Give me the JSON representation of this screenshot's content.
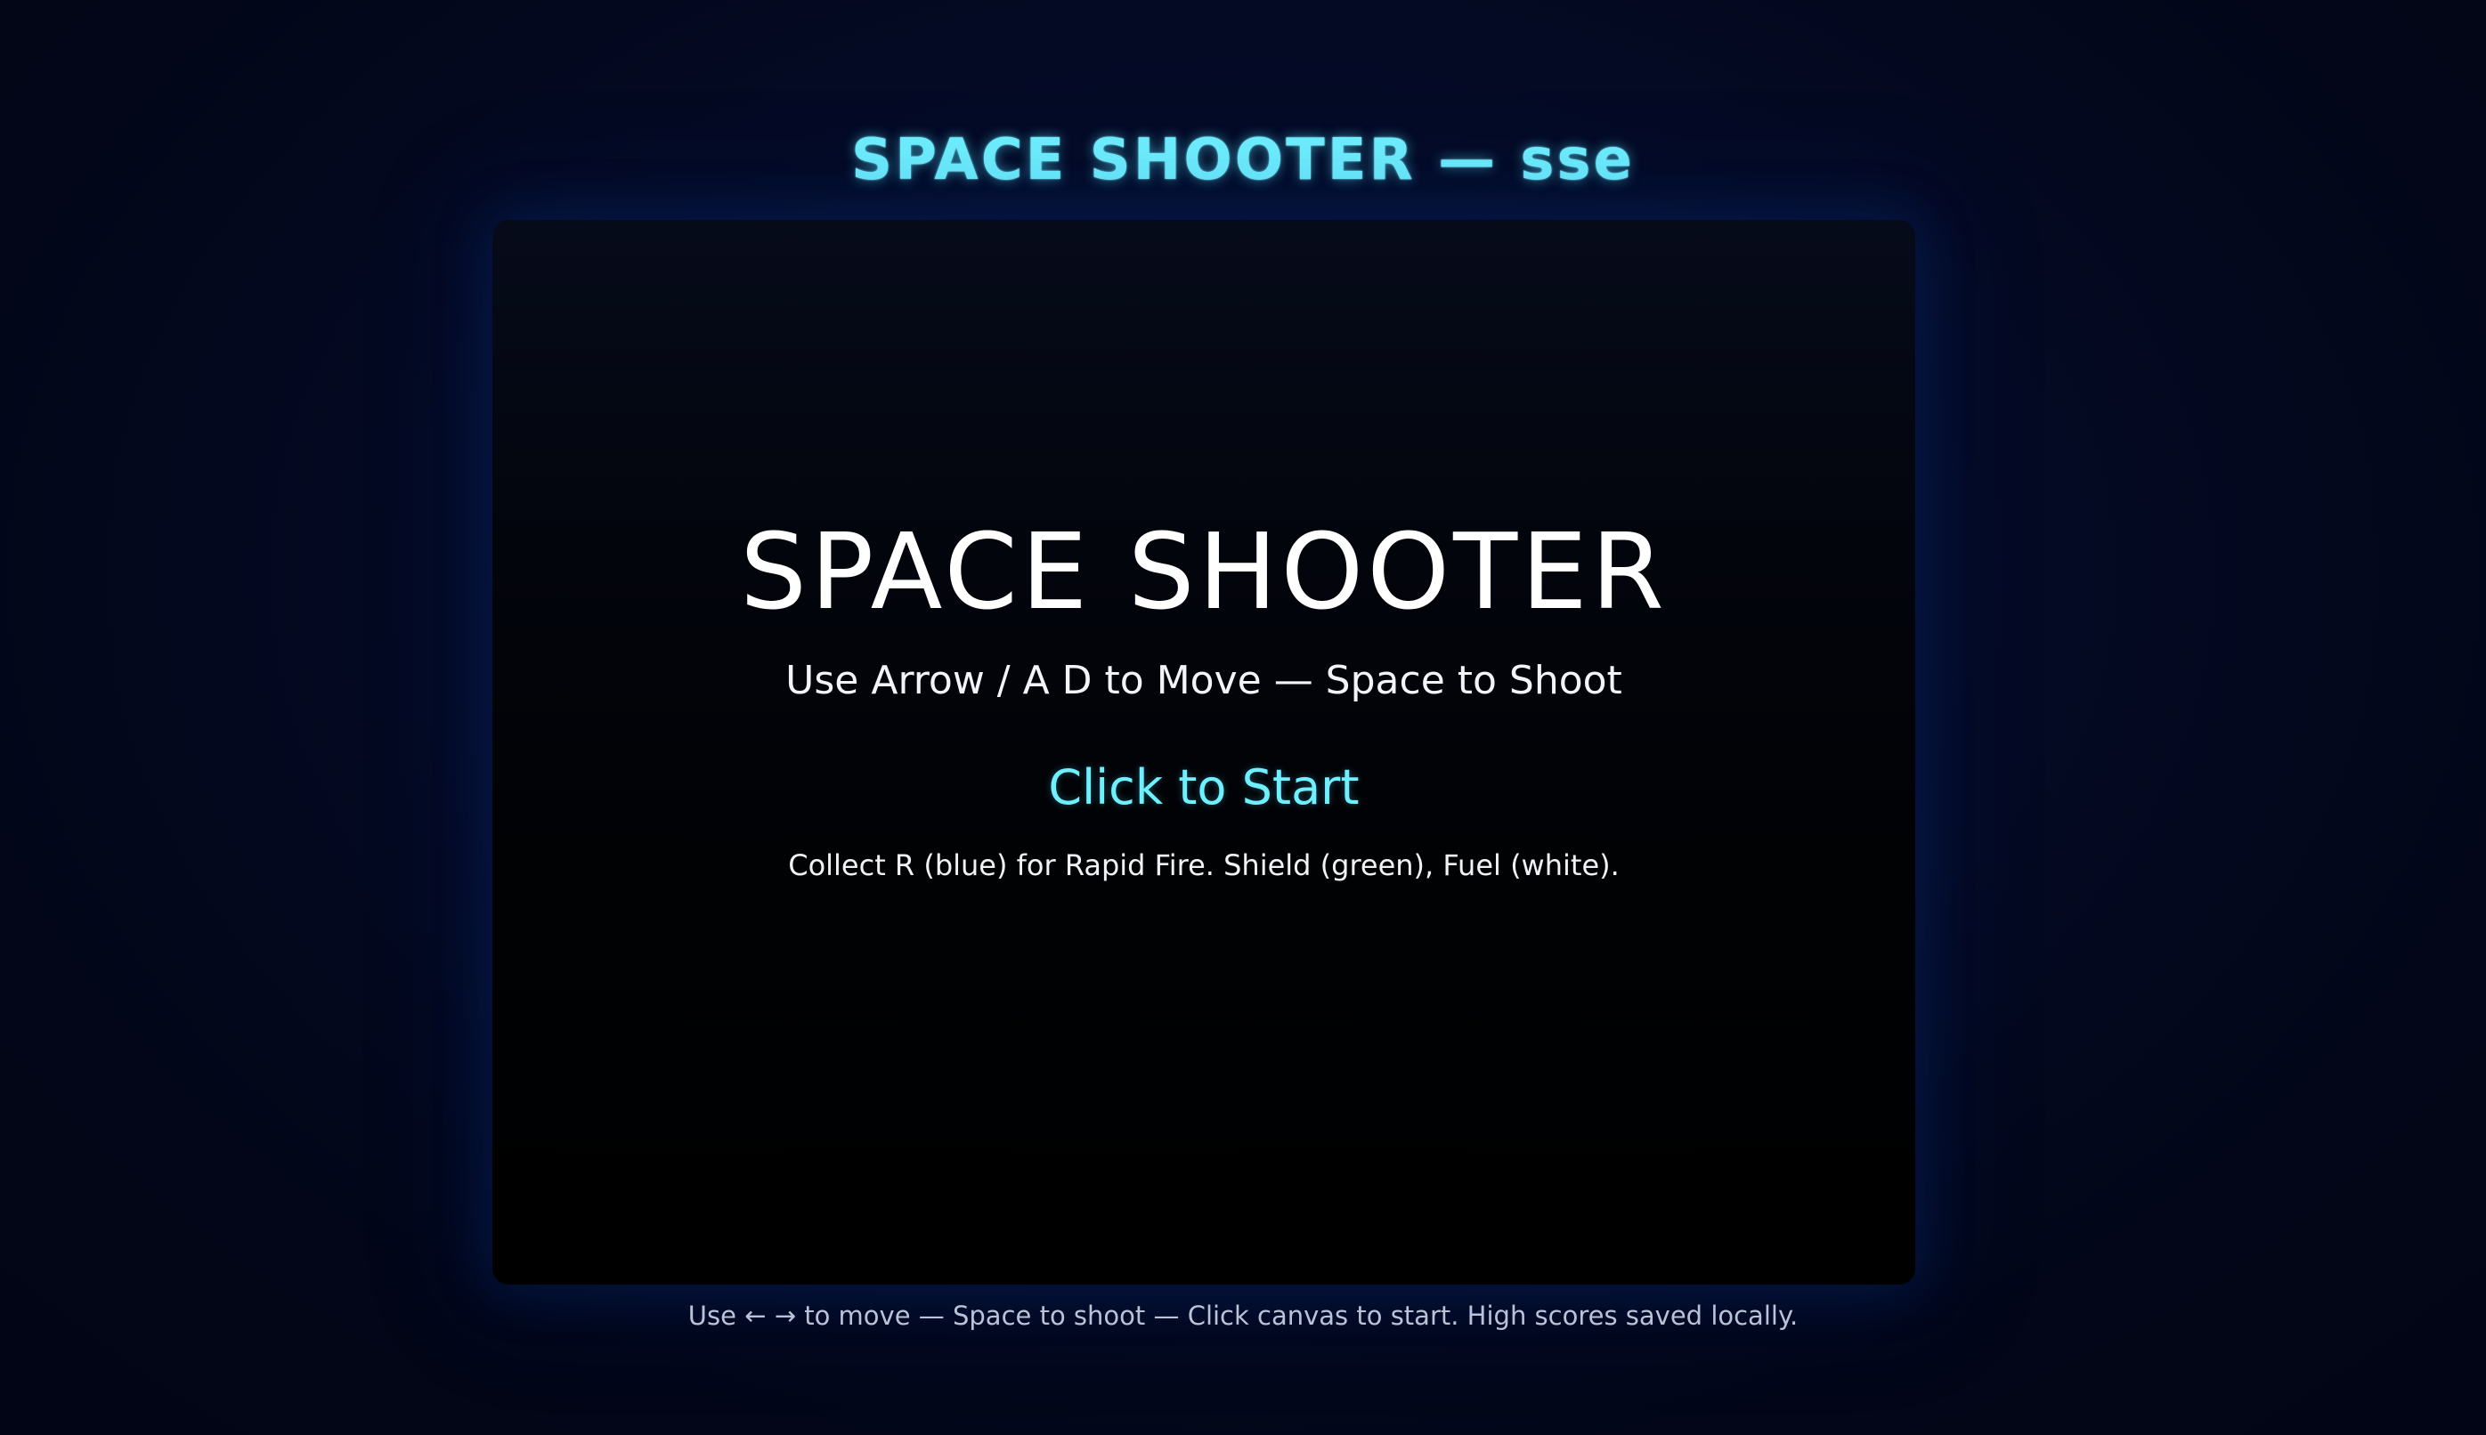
{
  "header": {
    "title": "SPACE SHOOTER — sse"
  },
  "canvas": {
    "title": "SPACE SHOOTER",
    "controls_text": "Use Arrow / A D to Move — Space to Shoot",
    "start_prompt": "Click to Start",
    "powerup_hint": "Collect R (blue) for Rapid Fire. Shield (green), Fuel (white)."
  },
  "footer": {
    "hint": "Use ← → to move — Space to shoot — Click canvas to start. High scores saved locally."
  },
  "colors": {
    "accent": "#6ef0ff",
    "background": "#020618",
    "canvas_bg": "#000000",
    "text": "#ffffff",
    "footer_text": "#b9c2d6"
  }
}
